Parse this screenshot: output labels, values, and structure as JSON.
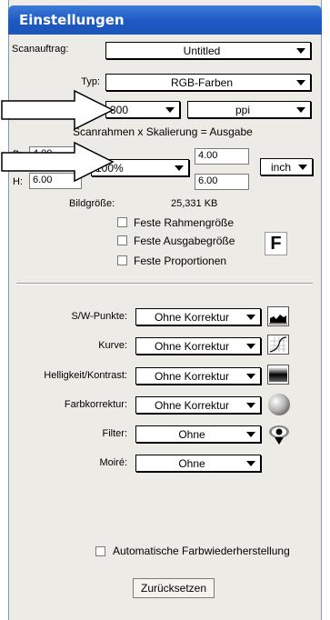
{
  "window": {
    "title": "Einstellungen"
  },
  "scan": {
    "job_label": "Scanauftrag:",
    "job_value": "Untitled",
    "type_label": "Typ:",
    "type_value": "RGB-Farben",
    "resolution_value": "300",
    "resolution_unit": "ppi",
    "formula": "Scanrahmen x Skalierung = Ausgabe",
    "width_label": "B:",
    "height_label": "H:",
    "frame_width": "4.00",
    "frame_height": "6.00",
    "scale_value": "100%",
    "output_width": "4.00",
    "output_height": "6.00",
    "dim_unit": "inch",
    "size_label": "Bildgröße:",
    "size_value": "25,331 KB"
  },
  "checkboxes": {
    "fixed_frame": "Feste Rahmengröße",
    "fixed_output": "Feste Ausgabegröße",
    "fixed_proportions": "Feste Proportionen",
    "badge": "F"
  },
  "corrections": [
    {
      "label": "S/W-Punkte:",
      "value": "Ohne Korrektur",
      "icon": "histogram-icon"
    },
    {
      "label": "Kurve:",
      "value": "Ohne Korrektur",
      "icon": "curve-icon"
    },
    {
      "label": "Helligkeit/Kontrast:",
      "value": "Ohne Korrektur",
      "icon": "brightness-contrast-icon"
    },
    {
      "label": "Farbkorrektur:",
      "value": "Ohne Korrektur",
      "icon": "color-sphere-icon"
    },
    {
      "label": "Filter:",
      "value": "Ohne",
      "icon": "filter-eye-icon"
    },
    {
      "label": "Moiré:",
      "value": "Ohne",
      "icon": ""
    }
  ],
  "footer": {
    "auto_color_label": "Automatische Farbwiederherstellung",
    "reset_label": "Zurücksetzen"
  }
}
